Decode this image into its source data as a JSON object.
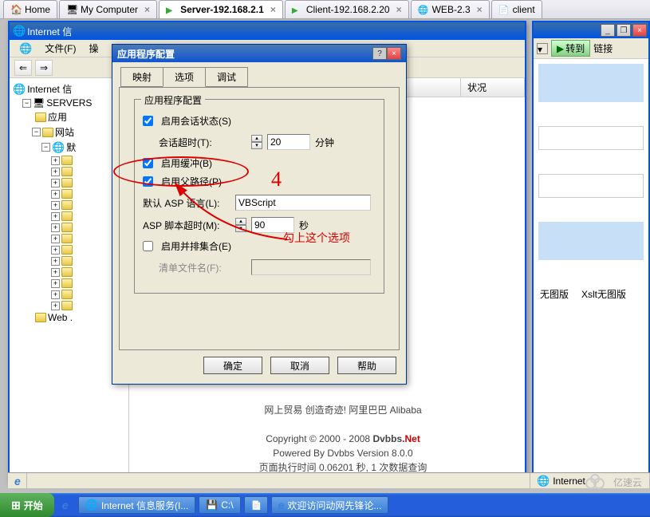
{
  "topTabs": [
    {
      "label": "Home",
      "icon": "home-icon"
    },
    {
      "label": "My Computer",
      "icon": "pc-icon"
    },
    {
      "label": "Server-192.168.2.1",
      "icon": "server-icon",
      "active": true
    },
    {
      "label": "Client-192.168.2.20",
      "icon": "server-icon"
    },
    {
      "label": "WEB-2.3",
      "icon": "web-icon"
    },
    {
      "label": "client",
      "icon": "app-icon"
    }
  ],
  "iis": {
    "title": "Internet 信",
    "menu": {
      "file": "文件(F)",
      "action": "操"
    },
    "tree": {
      "root": "Internet 信",
      "server": "SERVERS",
      "app": "应用",
      "site": "网站",
      "siteDefault": "默",
      "web": "Web ."
    },
    "listHeader": {
      "col1": "",
      "col2": "状况"
    }
  },
  "rightPanel": {
    "go": "转到",
    "links": "链接",
    "item1": "无图版",
    "item2": "Xslt无图版"
  },
  "dialog": {
    "title": "应用程序配置",
    "tabs": {
      "map": "映射",
      "options": "选项",
      "debug": "调试"
    },
    "group1": {
      "legend": "应用程序配置",
      "enableSession": "启用会话状态(S)",
      "sessionTimeout": "会话超时(T):",
      "sessionMinutes": "分钟",
      "sessionValue": "20",
      "enableBuffer": "启用缓冲(B)",
      "enableParentPath": "启用父路径(P)",
      "aspLang": "默认 ASP 语言(L):",
      "aspLangValue": "VBScript",
      "scriptTimeout": "ASP 脚本超时(M):",
      "scriptSeconds": "秒",
      "scriptValue": "90",
      "enableSideBySide": "启用并排集合(E)",
      "manifestFile": "清单文件名(F):"
    },
    "buttons": {
      "ok": "确定",
      "cancel": "取消",
      "help": "帮助"
    }
  },
  "annotations": {
    "number": "4",
    "hint": "勾上这个选项"
  },
  "pageText": {
    "line0": "网上贸易 创造奇迹! 阿里巴巴 Alibaba",
    "line1a": "Copyright © 2000 - 2008 ",
    "line1b": "Dvbbs",
    "line1c": ".Net",
    "line2": "Powered By Dvbbs Version 8.0.0",
    "line3": "页面执行时间 0.06201 秒, 1 次数据查询"
  },
  "statusbar": {
    "zone": "Internet"
  },
  "taskbar": {
    "start": "开始",
    "items": [
      {
        "label": "Internet 信息服务(I...",
        "icon": "globe-icon"
      },
      {
        "label": "C:\\",
        "icon": "drive-icon"
      },
      {
        "label": "",
        "icon": "page-icon"
      },
      {
        "label": "欢迎访问动网先锋论...",
        "icon": "ie-icon"
      }
    ]
  },
  "watermark": "亿速云"
}
